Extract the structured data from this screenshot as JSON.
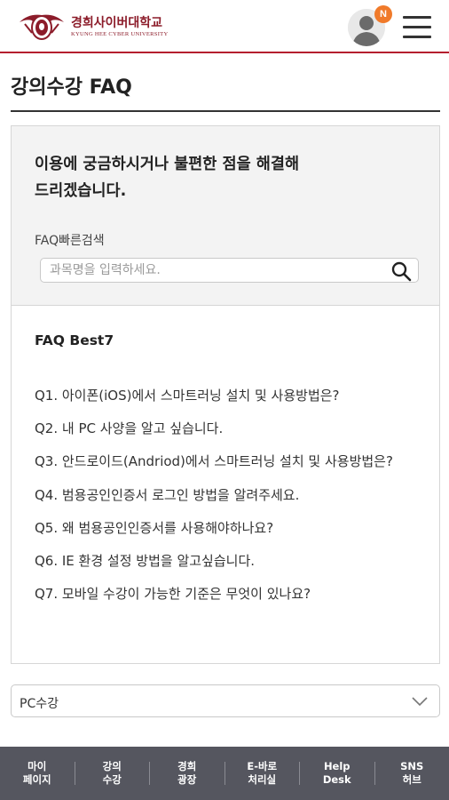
{
  "header": {
    "logo_ko": "경희사이버대학교",
    "logo_en": "KYUNG HEE CYBER UNIVERSITY",
    "notification_badge": "N"
  },
  "page": {
    "title": "강의수강 FAQ"
  },
  "search": {
    "intro_line1": "이용에 궁금하시거나 불편한 점을 해결해",
    "intro_line2": "드리겠습니다.",
    "label": "FAQ빠른검색",
    "placeholder": "과목명을 입력하세요."
  },
  "faq": {
    "heading": "FAQ Best7",
    "items": [
      "Q1. 아이폰(iOS)에서 스마트러닝 설치 및 사용방법은?",
      "Q2. 내 PC 사양을 알고 싶습니다.",
      "Q3. 안드로이드(Andriod)에서 스마트러닝 설치 및 사용방법은?",
      "Q4. 범용공인인증서 로그인 방법을 알려주세요.",
      "Q5. 왜 범용공인인증서를 사용해야하나요?",
      "Q6. IE 환경 설정 방법을 알고싶습니다.",
      "Q7. 모바일 수강이 가능한 기준은 무엇이 있나요?"
    ]
  },
  "category_select": {
    "selected": "PC수강"
  },
  "bottom_nav": [
    {
      "line1": "마이",
      "line2": "페이지"
    },
    {
      "line1": "강의",
      "line2": "수강"
    },
    {
      "line1": "경희",
      "line2": "광장"
    },
    {
      "line1": "E-바로",
      "line2": "처리실"
    },
    {
      "line1": "Help",
      "line2": "Desk"
    },
    {
      "line1": "SNS",
      "line2": "허브"
    }
  ],
  "colors": {
    "brand": "#8c1c2a",
    "header_rule": "#b51f2e",
    "badge": "#f07a2a",
    "nav_bg": "#55565f"
  },
  "icons": [
    "university-logo-icon",
    "user-avatar-icon",
    "hamburger-menu-icon",
    "search-icon",
    "chevron-down-icon"
  ]
}
